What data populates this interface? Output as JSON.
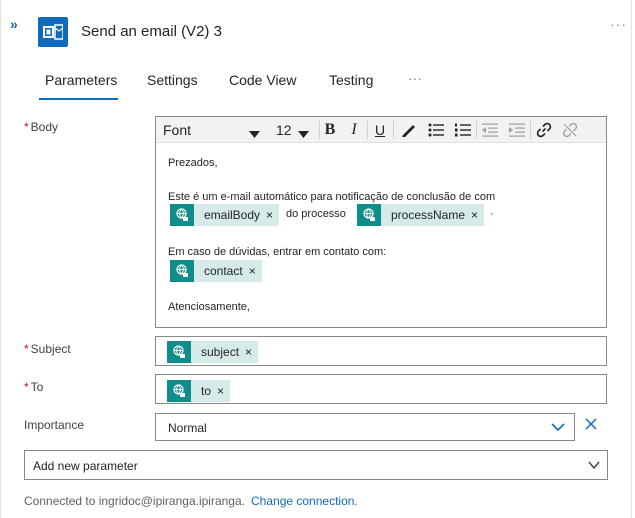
{
  "header": {
    "collapse_glyph": "»",
    "title": "Send an email (V2) 3",
    "more": "···",
    "app_icon": "outlook-icon"
  },
  "tabs": [
    {
      "label": "Parameters",
      "active": true
    },
    {
      "label": "Settings"
    },
    {
      "label": "Code View"
    },
    {
      "label": "Testing"
    }
  ],
  "tabs_more": "···",
  "body": {
    "label": "Body",
    "required_mark": "*",
    "toolbar": {
      "font": "Font",
      "size": "12",
      "bold": "B",
      "italic": "I",
      "underline": "U"
    },
    "lines": {
      "greeting": "Prezados,",
      "line1": "Este é um e-mail automático para notificação de conclusão de com",
      "between": "do processo",
      "dot": "·",
      "line2": "Em caso de dúvidas, entrar em contato com:",
      "closing": "Atenciosamente,"
    },
    "tokens": {
      "email_body": "emailBody",
      "process_name": "processName",
      "contact": "contact"
    }
  },
  "subject": {
    "label": "Subject",
    "required_mark": "*",
    "token": "subject"
  },
  "to": {
    "label": "To",
    "required_mark": "*",
    "token": "to"
  },
  "importance": {
    "label": "Importance",
    "value": "Normal"
  },
  "add_parameter": {
    "label": "Add new parameter"
  },
  "token_remove": "×",
  "footer": {
    "connected": "Connected to ingridoc@ipiranga.ipiranga.",
    "change": "Change connection."
  },
  "colors": {
    "accent": "#0f6cbd",
    "token_bg": "#d6eaea",
    "token_icon_bg": "#0f8c8c",
    "required": "#c50f1f"
  }
}
